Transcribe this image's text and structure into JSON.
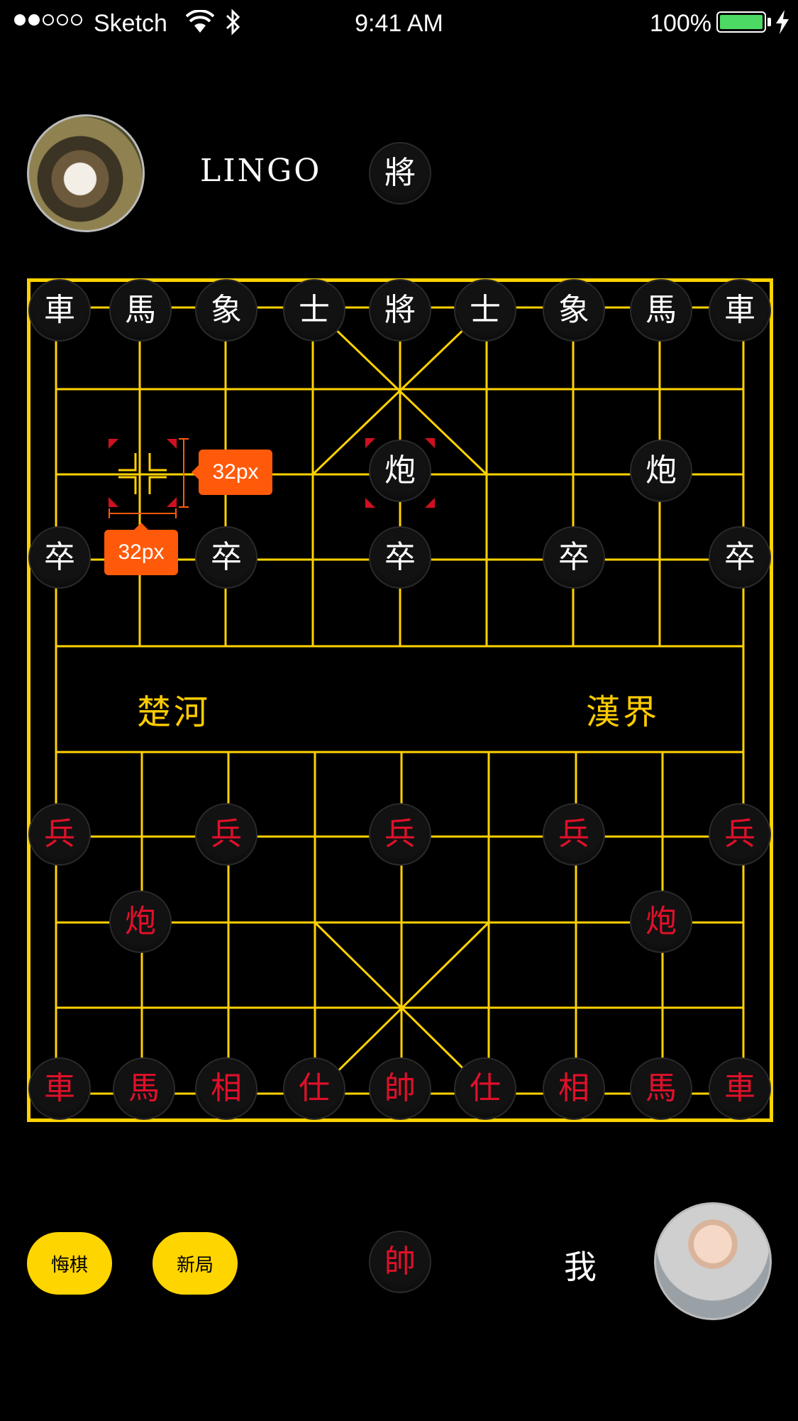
{
  "status_bar": {
    "carrier": "Sketch",
    "time": "9:41 AM",
    "battery": "100%",
    "signal_icon": "signal-dots-icon",
    "wifi_icon": "wifi-icon",
    "bluetooth_icon": "bluetooth-icon",
    "charge_icon": "charging-bolt-icon",
    "battery_color": "#4cd964"
  },
  "opponent": {
    "name": "LINGO",
    "side_piece": "將"
  },
  "me": {
    "name": "我",
    "side_piece": "帥"
  },
  "board": {
    "line_color": "#ffd200",
    "river_left": "楚河",
    "river_right": "漢界"
  },
  "pieces": {
    "black_back_row": [
      "車",
      "馬",
      "象",
      "士",
      "將",
      "士",
      "象",
      "馬",
      "車"
    ],
    "black_cannons": [
      "炮",
      "炮"
    ],
    "black_soldiers": [
      "卒",
      "卒",
      "卒",
      "卒",
      "卒"
    ],
    "red_soldiers": [
      "兵",
      "兵",
      "兵",
      "兵",
      "兵"
    ],
    "red_cannons": [
      "炮",
      "炮"
    ],
    "red_back_row": [
      "車",
      "馬",
      "相",
      "仕",
      "帥",
      "仕",
      "相",
      "馬",
      "車"
    ]
  },
  "annotations": {
    "vertical_size": "32px",
    "horizontal_size": "32px",
    "color": "#ff5a0a"
  },
  "buttons": {
    "undo": "悔棋",
    "new_game": "新局",
    "color": "#ffd500"
  }
}
